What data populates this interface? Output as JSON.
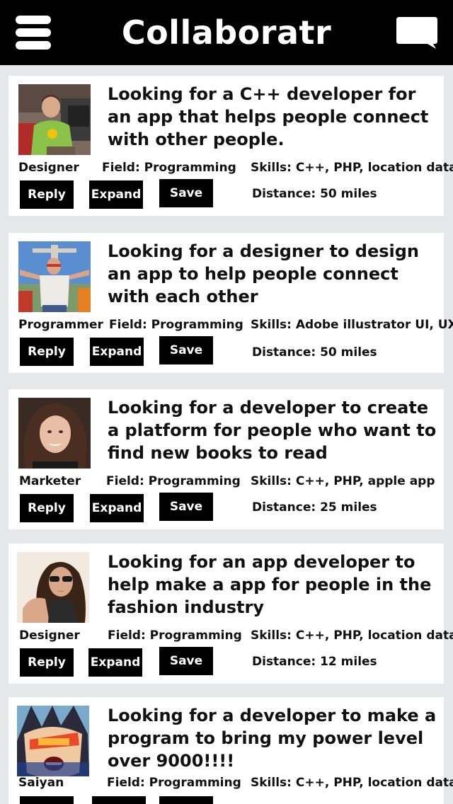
{
  "header": {
    "title": "Collaboratr",
    "menu_icon": "hamburger-menu-icon",
    "chat_icon": "chat-bubble-icon",
    "background": "#000000"
  },
  "buttons": {
    "reply": "Reply",
    "expand": "Expand",
    "save": "Save"
  },
  "posts": [
    {
      "title": "Looking for a C++ developer for an app that helps people connect with other people.",
      "role": "Designer",
      "field": "Field: Programming",
      "skills": "Skills: C++, PHP, location data",
      "distance": "Distance: 50 miles"
    },
    {
      "title": "Looking for a designer to design an app to help people connect with each other",
      "role": "Programmer",
      "field": "Field: Programming",
      "skills": "Skills: Adobe illustrator UI, UX",
      "distance": "Distance: 50 miles"
    },
    {
      "title": "Looking for a developer to create a platform for people who want to find new books to read",
      "role": "Marketer",
      "field": "Field: Programming",
      "skills": "Skills: C++, PHP, apple app",
      "distance": "Distance: 25 miles"
    },
    {
      "title": "Looking for an app developer to help make a app for people in the fashion industry",
      "role": "Designer",
      "field": "Field: Programming",
      "skills": "Skills: C++, PHP, location data",
      "distance": "Distance: 12 miles"
    },
    {
      "title": "Looking for a developer to make a program to bring my power level over 9000!!!!",
      "role": "Saiyan",
      "field": "Field: Programming",
      "skills": "Skills: C++, PHP, location data",
      "distance": ""
    }
  ]
}
